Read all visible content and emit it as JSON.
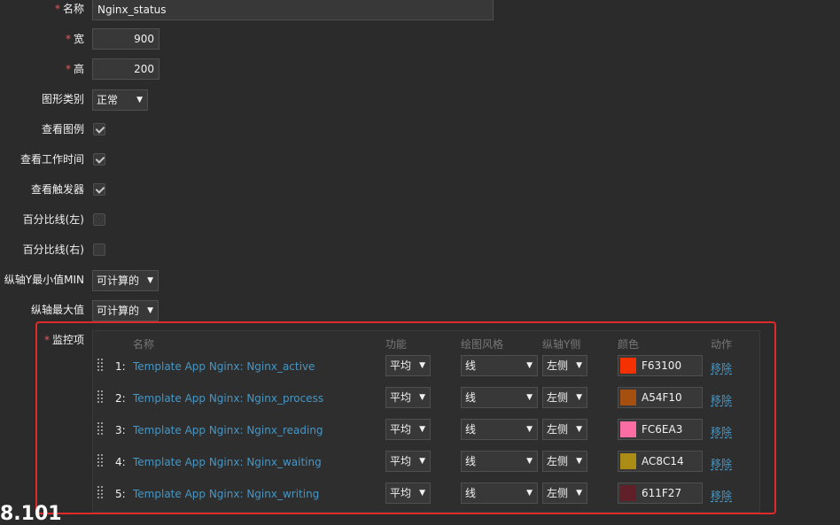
{
  "form": {
    "required_mark": "*",
    "name": {
      "label": "名称",
      "value": "Nginx_status"
    },
    "width": {
      "label": "宽",
      "value": "900"
    },
    "height": {
      "label": "高",
      "value": "200"
    },
    "graph_type": {
      "label": "图形类别",
      "value": "正常"
    },
    "show_legend": {
      "label": "查看图例",
      "checked": true
    },
    "show_working_time": {
      "label": "查看工作时间",
      "checked": true
    },
    "show_triggers": {
      "label": "查看触发器",
      "checked": true
    },
    "percentile_left": {
      "label": "百分比线(左)",
      "checked": false
    },
    "percentile_right": {
      "label": "百分比线(右)",
      "checked": false
    },
    "y_min": {
      "label": "纵轴Y最小值MIN",
      "value": "可计算的"
    },
    "y_max": {
      "label": "纵轴最大值",
      "value": "可计算的"
    }
  },
  "items": {
    "label": "监控项",
    "headers": {
      "name": "名称",
      "function": "功能",
      "draw_style": "绘图风格",
      "y_axis_side": "纵轴Y侧",
      "color": "颜色",
      "action": "动作"
    },
    "rows": [
      {
        "index": "1:",
        "name": "Template App Nginx: Nginx_active",
        "function": "平均",
        "draw_style": "线",
        "y_axis_side": "左侧",
        "color": "F63100",
        "color_hex": "#F63100",
        "action": "移除"
      },
      {
        "index": "2:",
        "name": "Template App Nginx: Nginx_process",
        "function": "平均",
        "draw_style": "线",
        "y_axis_side": "左侧",
        "color": "A54F10",
        "color_hex": "#A54F10",
        "action": "移除"
      },
      {
        "index": "3:",
        "name": "Template App Nginx: Nginx_reading",
        "function": "平均",
        "draw_style": "线",
        "y_axis_side": "左侧",
        "color": "FC6EA3",
        "color_hex": "#FC6EA3",
        "action": "移除"
      },
      {
        "index": "4:",
        "name": "Template App Nginx: Nginx_waiting",
        "function": "平均",
        "draw_style": "线",
        "y_axis_side": "左侧",
        "color": "AC8C14",
        "color_hex": "#AC8C14",
        "action": "移除"
      },
      {
        "index": "5:",
        "name": "Template App Nginx: Nginx_writing",
        "function": "平均",
        "draw_style": "线",
        "y_axis_side": "左侧",
        "color": "611F27",
        "color_hex": "#611F27",
        "action": "移除"
      }
    ]
  },
  "bottom_clipped_text": "8.101",
  "colors": {
    "background": "#2b2b2b",
    "link": "#4796c4",
    "required": "#e45959",
    "highlight_border": "#e02a2a"
  }
}
